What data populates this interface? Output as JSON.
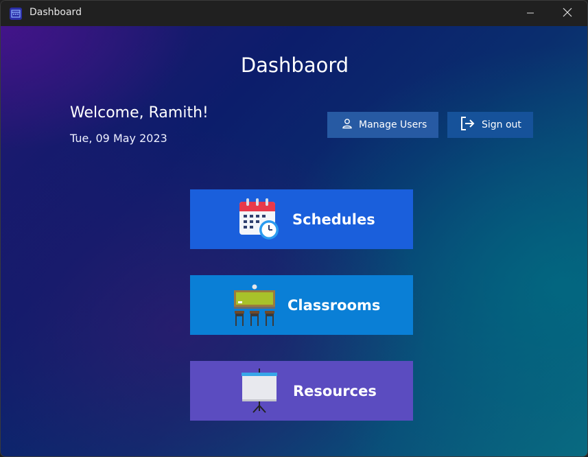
{
  "window": {
    "title": "Dashboard"
  },
  "header": {
    "title": "Dashbaord",
    "welcome": "Welcome, Ramith!",
    "date": "Tue, 09 May 2023"
  },
  "actions": {
    "manage_users": "Manage Users",
    "sign_out": "Sign out"
  },
  "tiles": [
    {
      "label": "Schedules",
      "icon": "calendar-clock-icon",
      "color": "#1a5fdc"
    },
    {
      "label": "Classrooms",
      "icon": "classroom-icon",
      "color": "#0a7fd6"
    },
    {
      "label": "Resources",
      "icon": "projector-screen-icon",
      "color": "#5b4cc0"
    }
  ]
}
